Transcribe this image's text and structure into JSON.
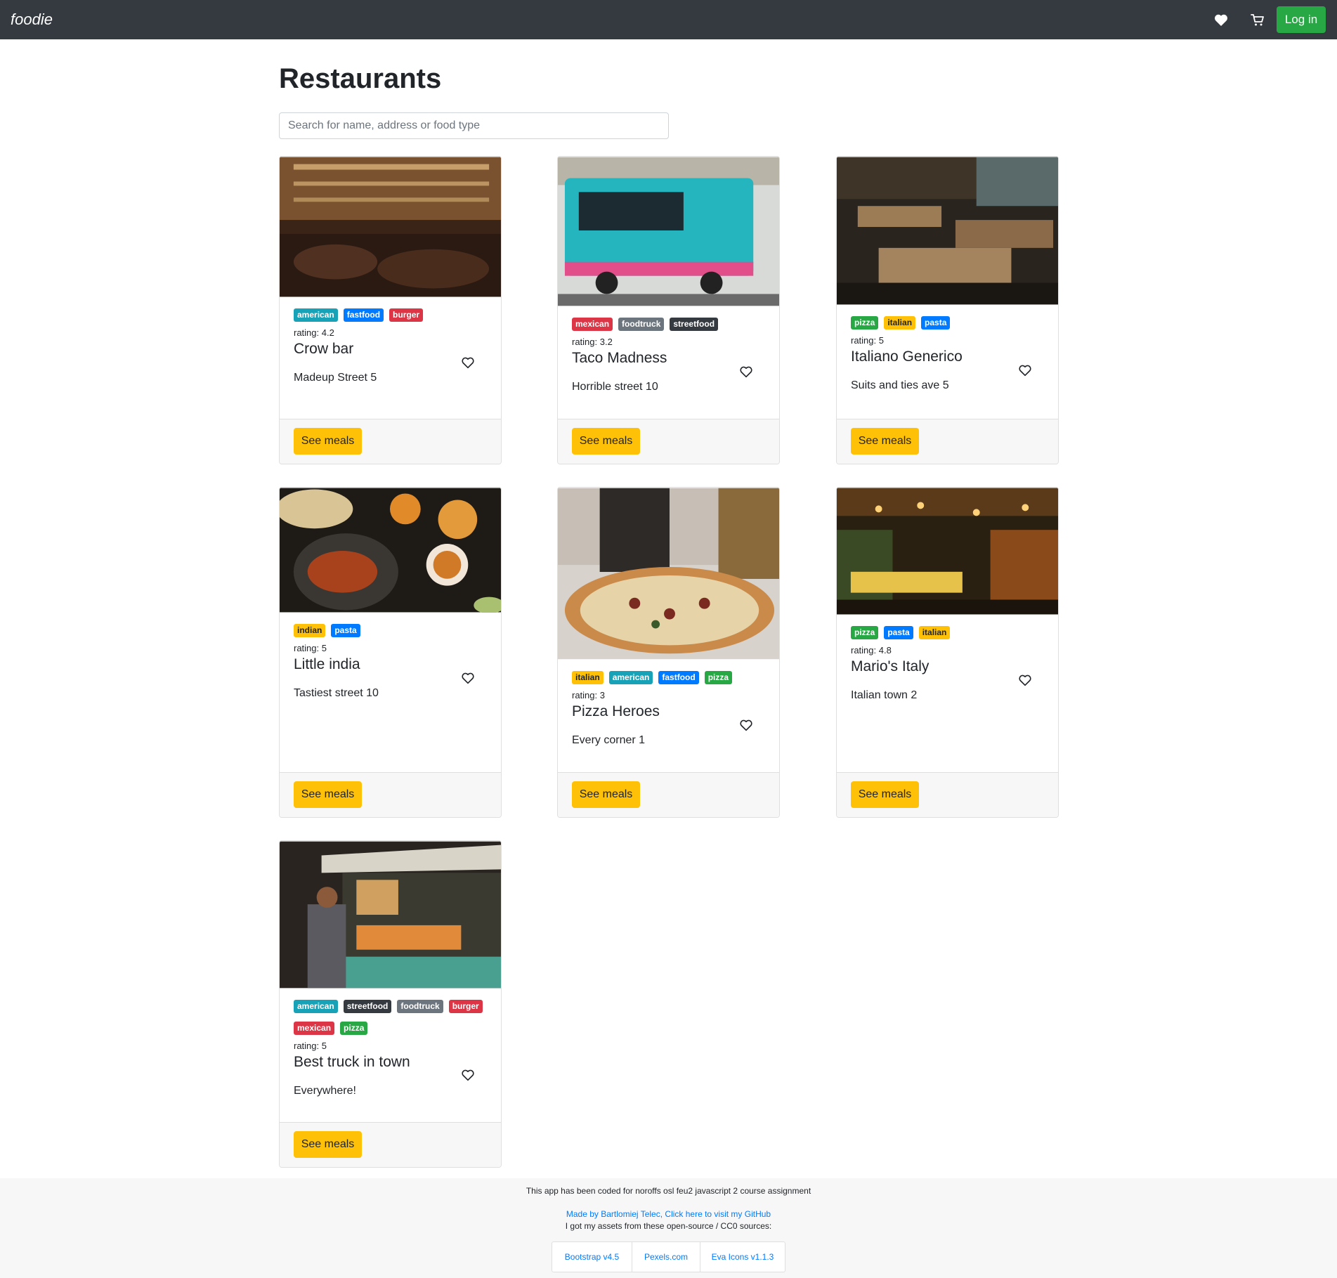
{
  "navbar": {
    "brand": "foodie",
    "favorites_icon": "heart-icon",
    "cart_icon": "cart-icon",
    "login_label": "Log in"
  },
  "page": {
    "title": "Restaurants",
    "search_placeholder": "Search for name, address or food type"
  },
  "tag_colors": {
    "american": "#17a2b8",
    "fastfood": "#007bff",
    "burger": "#dc3545",
    "mexican": "#dc3545",
    "foodtruck": "#6c757d",
    "streetfood": "#343a40",
    "pizza": "#28a745",
    "italian": "#ffc107",
    "pasta": "#007bff",
    "indian": "#ffc107"
  },
  "restaurants": [
    {
      "name": "Crow bar",
      "rating_label": "rating: 4.2",
      "address": "Madeup Street 5",
      "tags": [
        "american",
        "fastfood",
        "burger"
      ],
      "button_label": "See meals"
    },
    {
      "name": "Taco Madness",
      "rating_label": "rating: 3.2",
      "address": "Horrible street 10",
      "tags": [
        "mexican",
        "foodtruck",
        "streetfood"
      ],
      "button_label": "See meals"
    },
    {
      "name": "Italiano Generico",
      "rating_label": "rating: 5",
      "address": "Suits and ties ave 5",
      "tags": [
        "pizza",
        "italian",
        "pasta"
      ],
      "button_label": "See meals"
    },
    {
      "name": "Little india",
      "rating_label": "rating: 5",
      "address": "Tastiest street 10",
      "tags": [
        "indian",
        "pasta"
      ],
      "button_label": "See meals"
    },
    {
      "name": "Pizza Heroes",
      "rating_label": "rating: 3",
      "address": "Every corner 1",
      "tags": [
        "italian",
        "american",
        "fastfood",
        "pizza"
      ],
      "button_label": "See meals"
    },
    {
      "name": "Mario's Italy",
      "rating_label": "rating: 4.8",
      "address": "Italian town 2",
      "tags": [
        "pizza",
        "pasta",
        "italian"
      ],
      "button_label": "See meals"
    },
    {
      "name": "Best truck in town",
      "rating_label": "rating: 5",
      "address": "Everywhere!",
      "tags": [
        "american",
        "streetfood",
        "foodtruck",
        "burger",
        "mexican",
        "pizza"
      ],
      "button_label": "See meals"
    }
  ],
  "footer": {
    "note": "This app has been coded for noroffs osl feu2 javascript 2 course assignment",
    "github_link": "Made by Bartlomiej Telec, Click here to visit my GitHub",
    "sources_text": "I got my assets from these open-source / CC0 sources:",
    "sources": [
      "Bootstrap v4.5",
      "Pexels.com",
      "Eva Icons v1.1.3"
    ]
  }
}
